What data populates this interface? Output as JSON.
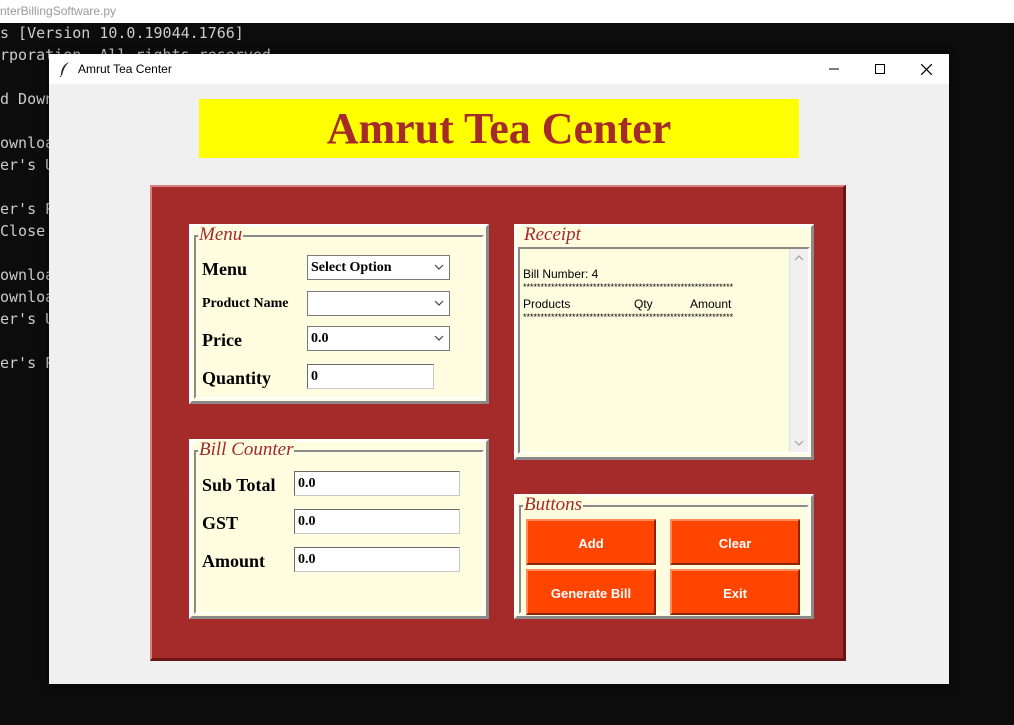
{
  "console": {
    "tab_title": "nterBillingSoftware.py",
    "lines": [
      "s [Version 10.0.19044.1766]",
      "rporation. All rights reserved.",
      "d Down",
      "ownloa",
      "er's U",
      "er's P",
      " Close",
      "ownloa",
      "ownloa",
      "er's U",
      "er's P"
    ]
  },
  "window": {
    "title": "Amrut Tea Center",
    "icon": "feather-icon",
    "controls": {
      "minimize": "minimize-icon",
      "maximize": "maximize-icon",
      "close": "close-icon"
    }
  },
  "app": {
    "title": "Amrut Tea Center",
    "colors": {
      "title_bg": "#ffff00",
      "title_fg": "#a52a2a",
      "panel_bg": "#a52a2a",
      "frame_bg": "#fffde0",
      "button_bg": "#ff4500"
    }
  },
  "menu": {
    "legend": "Menu",
    "menu_label": "Menu",
    "menu_value": "Select Option",
    "product_label": "Product Name",
    "product_value": "",
    "price_label": "Price",
    "price_value": "0.0",
    "quantity_label": "Quantity",
    "quantity_value": "0"
  },
  "bill_counter": {
    "legend": "Bill Counter",
    "subtotal_label": "Sub Total",
    "subtotal_value": "0.0",
    "gst_label": "GST",
    "gst_value": "0.0",
    "amount_label": "Amount",
    "amount_value": "0.0"
  },
  "receipt": {
    "legend": "Receipt",
    "bill_number": "Bill Number: 4",
    "separator": "************************************************************",
    "col_products": "Products",
    "col_qty": "Qty",
    "col_amount": "Amount"
  },
  "buttons": {
    "legend": "Buttons",
    "add": "Add",
    "clear": "Clear",
    "generate": "Generate Bill",
    "exit": "Exit"
  }
}
